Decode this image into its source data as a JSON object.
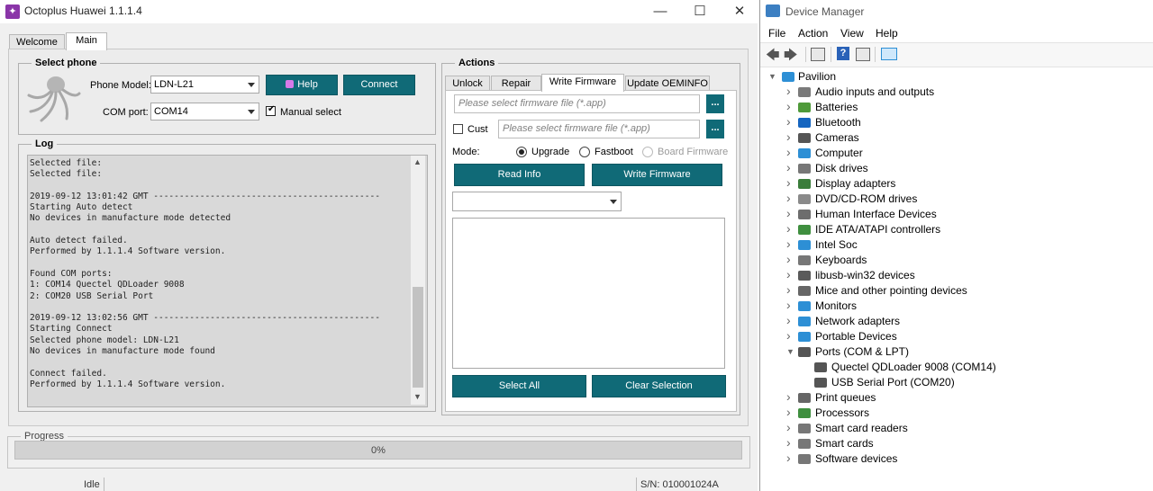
{
  "octoplus": {
    "title": "Octoplus Huawei 1.1.1.4",
    "tabs": [
      "Welcome",
      "Main"
    ],
    "select_phone": {
      "legend": "Select phone",
      "phone_model_label": "Phone Model:",
      "phone_model_value": "LDN-L21",
      "com_port_label": "COM port:",
      "com_port_value": "COM14",
      "help_label": "Help",
      "connect_label": "Connect",
      "manual_select_label": "Manual select"
    },
    "log": {
      "legend": "Log",
      "lines": [
        "Selected file:",
        "Selected file:",
        "",
        "2019-09-12 13:01:42 GMT --------------------------------------------",
        "Starting Auto detect",
        "No devices in manufacture mode detected",
        "",
        "Auto detect failed.",
        "Performed by 1.1.1.4 Software version.",
        "",
        "Found COM ports:",
        "1: COM14 Quectel QDLoader 9008",
        "2: COM20 USB Serial Port",
        "",
        "2019-09-12 13:02:56 GMT --------------------------------------------",
        "Starting Connect",
        "Selected phone model: LDN-L21",
        "No devices in manufacture mode found",
        "",
        "Connect failed.",
        "Performed by 1.1.1.4 Software version."
      ]
    },
    "actions": {
      "legend": "Actions",
      "tabs": [
        "Unlock",
        "Repair",
        "Write Firmware",
        "Update OEMINFO"
      ],
      "firmware_placeholder": "Please select firmware file (*.app)",
      "cust_label": "Cust",
      "cust_placeholder": "Please select firmware file (*.app)",
      "browse_label": "...",
      "mode_label": "Mode:",
      "mode_upgrade": "Upgrade",
      "mode_fastboot": "Fastboot",
      "mode_board": "Board Firmware",
      "read_info_label": "Read Info",
      "write_firmware_label": "Write Firmware",
      "select_all_label": "Select All",
      "clear_selection_label": "Clear Selection"
    },
    "progress": {
      "legend": "Progress",
      "percent_text": "0%",
      "value": 0
    },
    "status": {
      "state": "Idle",
      "serial": "S/N: 010001024A"
    }
  },
  "device_manager": {
    "title": "Device Manager",
    "menu": [
      "File",
      "Action",
      "View",
      "Help"
    ],
    "root": "Pavilion",
    "items": [
      {
        "label": "Audio inputs and outputs",
        "icon": "speaker-icon",
        "color": "#7a7a7a"
      },
      {
        "label": "Batteries",
        "icon": "battery-icon",
        "color": "#4f9a3a"
      },
      {
        "label": "Bluetooth",
        "icon": "bluetooth-icon",
        "color": "#1565c0"
      },
      {
        "label": "Cameras",
        "icon": "camera-icon",
        "color": "#555555"
      },
      {
        "label": "Computer",
        "icon": "computer-icon",
        "color": "#2d8fd5"
      },
      {
        "label": "Disk drives",
        "icon": "disk-icon",
        "color": "#777777"
      },
      {
        "label": "Display adapters",
        "icon": "display-adapter-icon",
        "color": "#3a7d3a"
      },
      {
        "label": "DVD/CD-ROM drives",
        "icon": "dvd-icon",
        "color": "#8a8a8a"
      },
      {
        "label": "Human Interface Devices",
        "icon": "hid-icon",
        "color": "#6d6d6d"
      },
      {
        "label": "IDE ATA/ATAPI controllers",
        "icon": "ide-icon",
        "color": "#3f8f3f"
      },
      {
        "label": "Intel Soc",
        "icon": "soc-icon",
        "color": "#2d8fd5"
      },
      {
        "label": "Keyboards",
        "icon": "keyboard-icon",
        "color": "#777777"
      },
      {
        "label": "libusb-win32 devices",
        "icon": "usb-icon",
        "color": "#5a5a5a"
      },
      {
        "label": "Mice and other pointing devices",
        "icon": "mouse-icon",
        "color": "#666666"
      },
      {
        "label": "Monitors",
        "icon": "monitor-icon",
        "color": "#2d8fd5"
      },
      {
        "label": "Network adapters",
        "icon": "network-icon",
        "color": "#2d8fd5"
      },
      {
        "label": "Portable Devices",
        "icon": "portable-device-icon",
        "color": "#2d8fd5"
      },
      {
        "label": "Ports (COM & LPT)",
        "icon": "port-icon",
        "color": "#555555",
        "expanded": true,
        "children": [
          "Quectel QDLoader 9008 (COM14)",
          "USB Serial Port (COM20)"
        ]
      },
      {
        "label": "Print queues",
        "icon": "printer-icon",
        "color": "#666666"
      },
      {
        "label": "Processors",
        "icon": "processor-icon",
        "color": "#3f8f3f"
      },
      {
        "label": "Smart card readers",
        "icon": "smartcard-icon",
        "color": "#777777"
      },
      {
        "label": "Smart cards",
        "icon": "smartcard-icon",
        "color": "#777777"
      },
      {
        "label": "Software devices",
        "icon": "software-device-icon",
        "color": "#777777"
      }
    ]
  },
  "colors": {
    "accent": "#106a77",
    "octo_purple": "#8a35a8"
  }
}
